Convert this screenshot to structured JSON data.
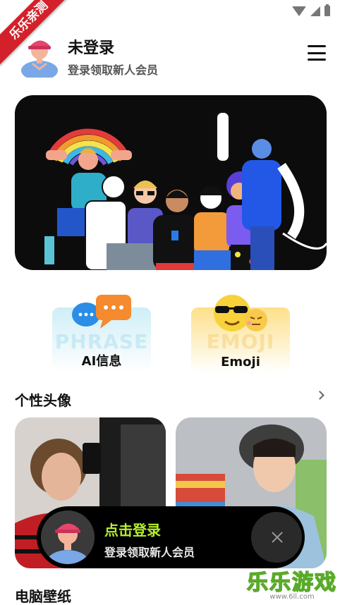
{
  "ribbon": {
    "text": "乐乐亲测"
  },
  "header": {
    "user_name": "未登录",
    "user_sub": "登录领取新人会员"
  },
  "features": [
    {
      "label": "AI信息",
      "watermark": "PHRASE"
    },
    {
      "label": "Emoji",
      "watermark": "EMOJI"
    }
  ],
  "sections": {
    "avatars_title": "个性头像",
    "wallpaper_title": "电脑壁纸"
  },
  "login_bar": {
    "title": "点击登录",
    "sub": "登录领取新人会员"
  },
  "watermark": {
    "big": "乐乐游戏",
    "small": "www.6ll.com"
  },
  "colors": {
    "accent_green": "#b6f12b",
    "ribbon_red": "#d3202a",
    "banner_bg": "#0c0c0c"
  }
}
